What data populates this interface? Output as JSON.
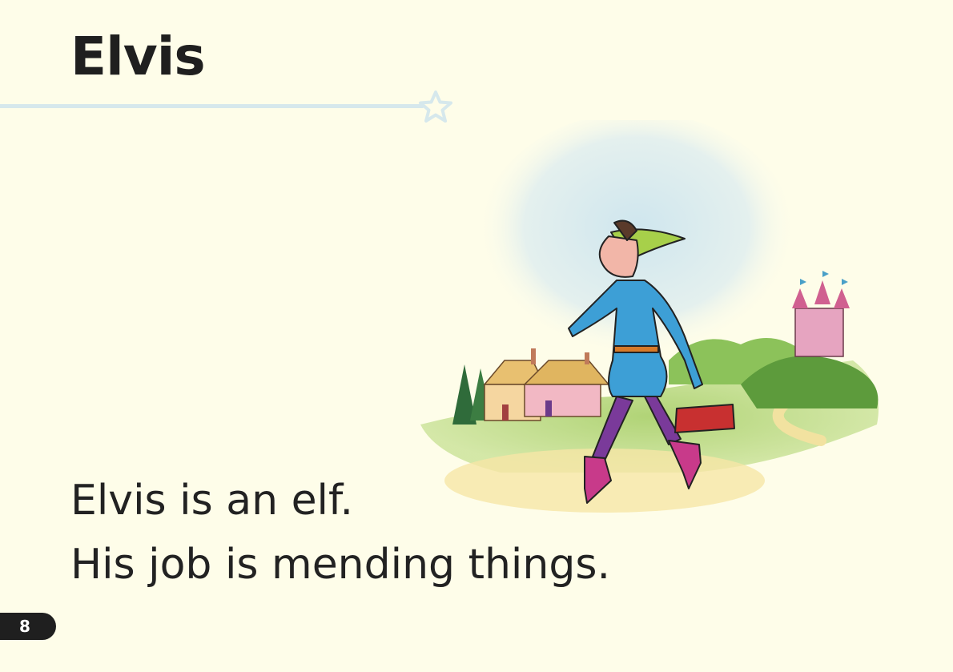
{
  "page": {
    "title": "Elvis",
    "lines": [
      "Elvis is an elf.",
      "His job is mending things."
    ],
    "page_number": "8"
  },
  "colors": {
    "background": "#fefde9",
    "rule": "#d6e8ec",
    "text": "#222222",
    "tab": "#1f1f1f"
  },
  "illustration": {
    "subject": "elf-walking-with-toolbag",
    "icon": "star-icon"
  }
}
